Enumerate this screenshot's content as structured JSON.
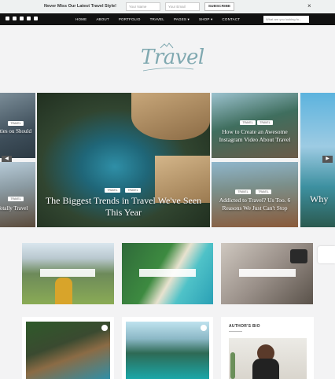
{
  "topbar": {
    "message": "Never Miss Our Latest Travel Style!",
    "name_placeholder": "Your Name",
    "email_placeholder": "Your Email",
    "subscribe_label": "SUBSCRIBE",
    "close_label": "×"
  },
  "nav": {
    "items": [
      "HOME",
      "ABOUT",
      "PORTFOLIO",
      "TRAVEL",
      "PAGES ▾",
      "SHOP ▾",
      "CONTACT"
    ],
    "search_placeholder": "What are you looking fo..."
  },
  "logo": {
    "text": "Travel"
  },
  "slider": {
    "left_top_caption": "mmunities ou Should",
    "left_bottom_caption": "s to Totally Travel",
    "main_caption": "The Biggest Trends in Travel We've Seen This Year",
    "right_top_caption": "How to Create an Awesome Instagram Video About Travel",
    "right_bottom_caption": "Addicted to Travel? Us Too. 6 Reasons We Just Can't Stop",
    "far_right_caption": "Why",
    "tag_label": "TRAVEL",
    "prev_arrow": "◀",
    "next_arrow": "▶"
  },
  "bio": {
    "title": "AUTHOR'S BIO"
  },
  "icons": {
    "brand_color": "#7fa8b0"
  }
}
